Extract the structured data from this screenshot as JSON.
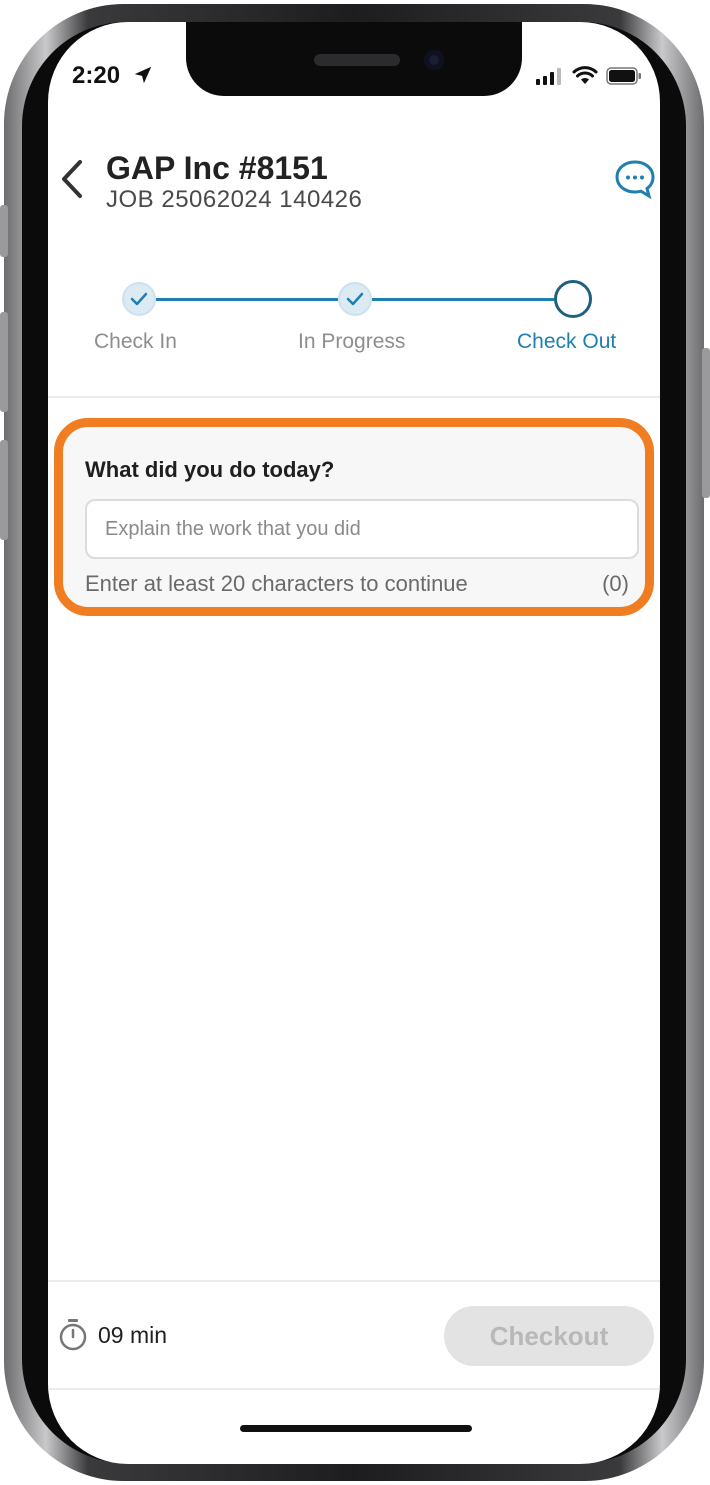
{
  "status_bar": {
    "time": "2:20"
  },
  "header": {
    "title": "GAP Inc #8151",
    "subtitle": "JOB 25062024 140426"
  },
  "stepper": {
    "steps": [
      {
        "label": "Check In",
        "state": "done"
      },
      {
        "label": "In Progress",
        "state": "done"
      },
      {
        "label": "Check Out",
        "state": "current"
      }
    ]
  },
  "form": {
    "question": "What did you do today?",
    "answer_value": "",
    "answer_placeholder": "Explain the work that you did",
    "hint": "Enter at least 20 characters to continue",
    "char_count": "(0)"
  },
  "footer": {
    "timer": "09 min",
    "checkout_label": "Checkout"
  },
  "colors": {
    "accent": "#1f7fae",
    "highlight": "#f07d22",
    "disabled_button": "#e3e3e3"
  }
}
